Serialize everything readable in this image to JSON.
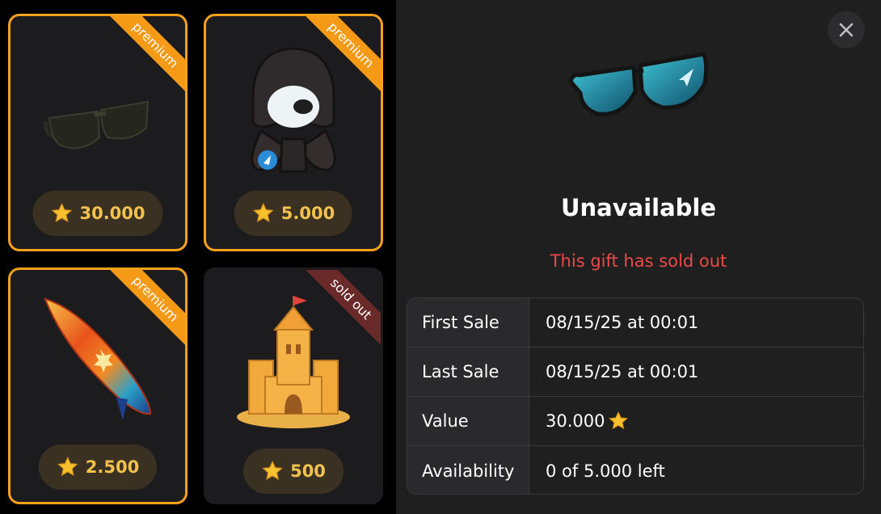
{
  "gifts": [
    {
      "ribbon": "premium",
      "price": "30.000",
      "art": "sunglasses-icon"
    },
    {
      "ribbon": "premium",
      "price": "5.000",
      "art": "hooded-plush-icon"
    },
    {
      "ribbon": "premium",
      "price": "2.500",
      "art": "surfboard-icon"
    },
    {
      "ribbon": "sold out",
      "price": "500",
      "art": "sandcastle-icon"
    }
  ],
  "detail": {
    "title": "Unavailable",
    "subtitle": "This gift has sold out",
    "rows": [
      {
        "label": "First Sale",
        "value": "08/15/25 at 00:01"
      },
      {
        "label": "Last Sale",
        "value": "08/15/25 at 00:01"
      },
      {
        "label": "Value",
        "value": "30.000"
      },
      {
        "label": "Availability",
        "value": "0 of 5.000 left"
      }
    ]
  },
  "colors": {
    "premium": "#f7a11a",
    "sold_out": "#6b2a2a",
    "accent_red": "#ec4a48",
    "star": "#f3c24e"
  }
}
